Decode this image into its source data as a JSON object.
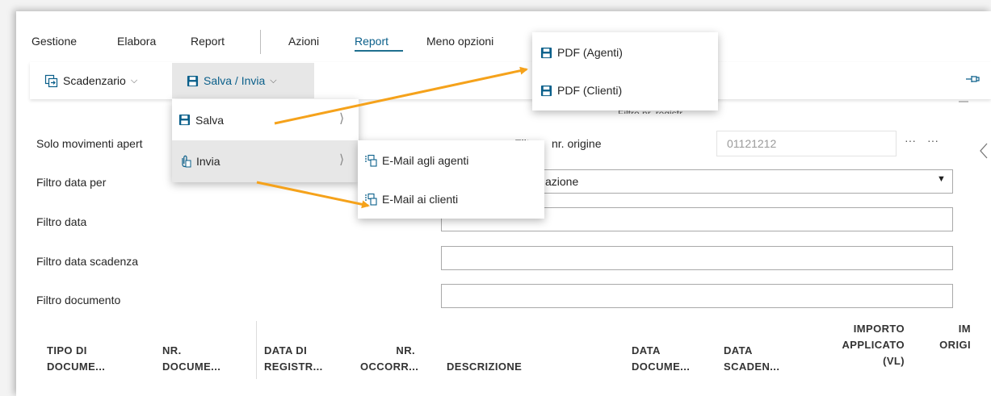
{
  "nav": {
    "items": [
      "Gestione",
      "Elabora",
      "Report",
      "Azioni",
      "Report",
      "Meno opzioni"
    ]
  },
  "actionbar": {
    "scadenzario_label": "Scadenzario",
    "salva_invia_label": "Salva / Invia"
  },
  "menu_salva_invia": {
    "salva_label": "Salva",
    "invia_label": "Invia"
  },
  "submenu_salva": {
    "pdf_agenti": "PDF (Agenti)",
    "pdf_clienti": "PDF (Clienti)"
  },
  "submenu_invia": {
    "email_agenti": "E-Mail agli agenti",
    "email_clienti": "E-Mail ai clienti"
  },
  "form": {
    "solo_movimenti_label": "Solo movimenti apert",
    "filtro_data_per_label": "Filtro data per",
    "filtro_data_label": "Filtro data",
    "filtro_data_scadenza_label": "Filtro data scadenza",
    "filtro_documento_label": "Filtro documento",
    "filtro_nr_origine_label_a": "Filt",
    "filtro_nr_origine_label_b": "nr. origine",
    "filtro_nr_origine_value": "01121212",
    "filtro_data_per_value": "azione",
    "partial_label_top": "Filtro nr. registr."
  },
  "table": {
    "columns": [
      [
        "TIPO DI",
        "DOCUME..."
      ],
      [
        "NR.",
        "DOCUME..."
      ],
      [
        "DATA DI",
        "REGISTR..."
      ],
      [
        "NR.",
        "OCCORR..."
      ],
      [
        "DESCRIZIONE"
      ],
      [
        "DATA",
        "DOCUME..."
      ],
      [
        "DATA",
        "SCADEN..."
      ],
      [
        "IMPORTO",
        "APPLICATO",
        "(VL)"
      ],
      [
        "IM",
        "ORIGI"
      ]
    ]
  },
  "colors": {
    "accent": "#0a5f8a",
    "arrow": "#f5a21b",
    "menu_bg": "#e7e7e7"
  }
}
